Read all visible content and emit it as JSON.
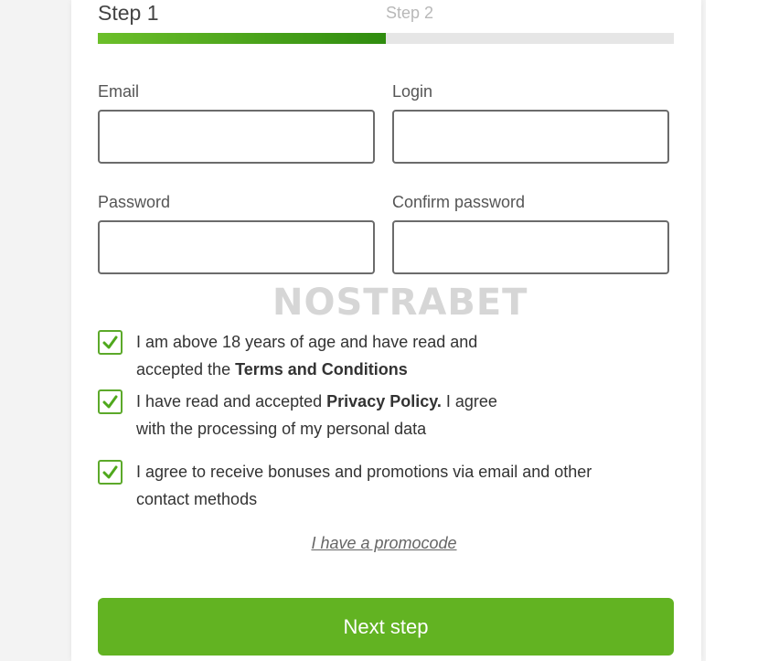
{
  "steps": {
    "step1_label": "Step 1",
    "step2_label": "Step 2",
    "progress_percent": 50
  },
  "form": {
    "email_label": "Email",
    "email_value": "",
    "login_label": "Login",
    "login_value": "",
    "password_label": "Password",
    "password_value": "",
    "confirm_password_label": "Confirm password",
    "confirm_password_value": ""
  },
  "watermark": "NOSTRABET",
  "checkboxes": [
    {
      "checked": true,
      "line1_pre": "I am above 18 years of age and have read and",
      "line2_pre": "accepted the ",
      "link": "Terms and Conditions",
      "post": ""
    },
    {
      "checked": true,
      "line1_pre": "I have read and accepted ",
      "link": "Privacy Policy.",
      "line1_post": " I agree",
      "line2": "with the processing of my personal data"
    },
    {
      "checked": true,
      "line1": "I agree to receive bonuses and promotions via email and other",
      "line2": "contact methods"
    }
  ],
  "promo_link": "I have a promocode",
  "next_button": "Next step",
  "colors": {
    "accent": "#62b322",
    "progress_start": "#6cbf2a",
    "progress_end": "#2f8c0f",
    "checkbox_border": "#5ca92a"
  }
}
